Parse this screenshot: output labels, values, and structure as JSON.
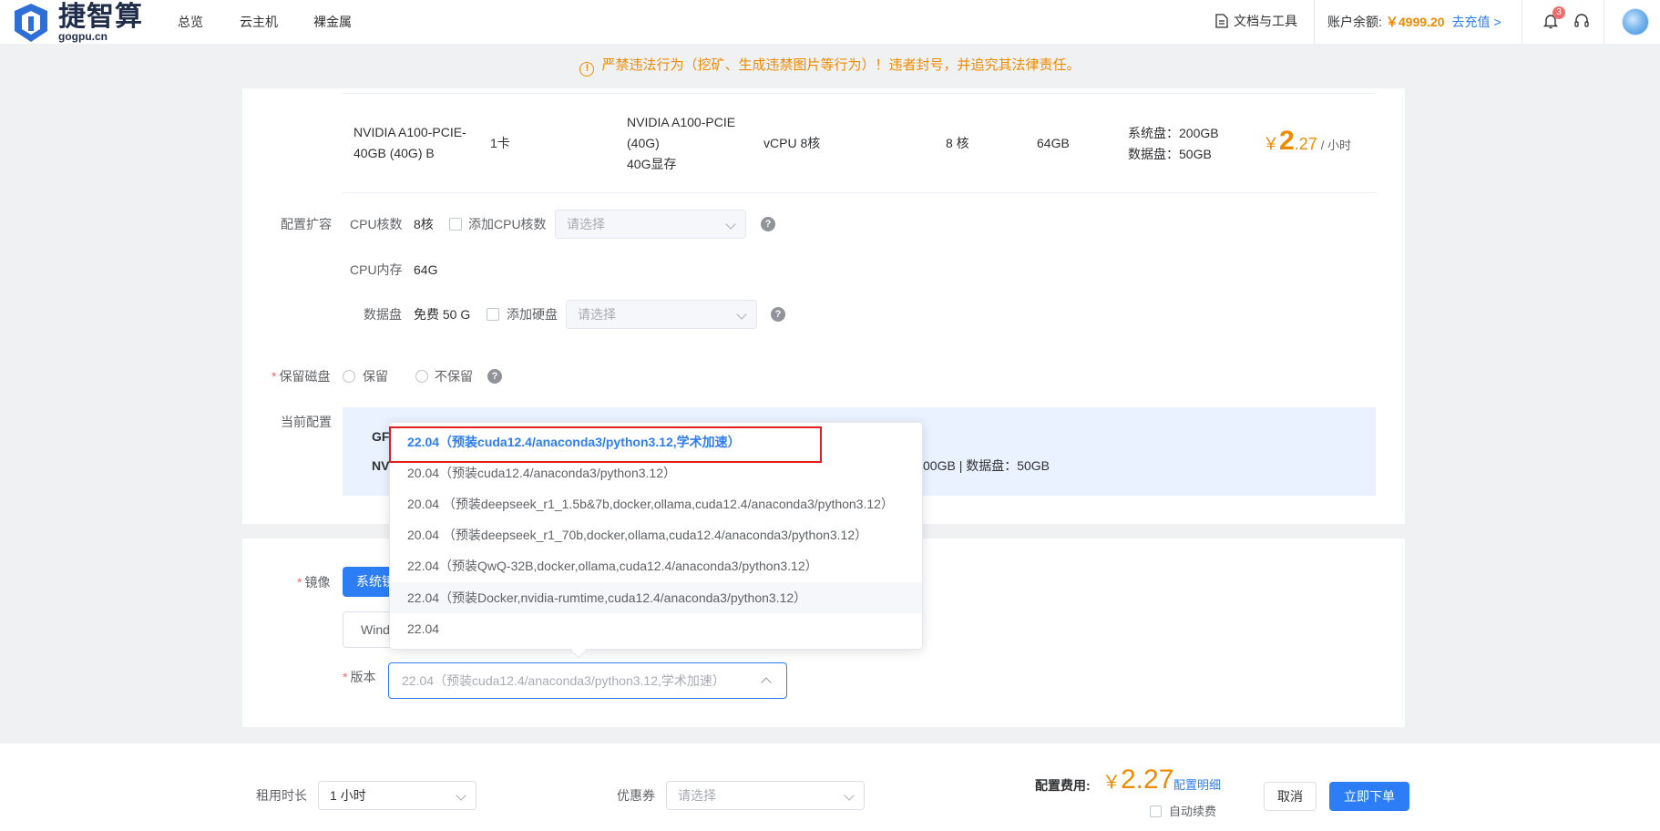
{
  "header": {
    "logo_text": "捷智算",
    "logo_sub": "gogpu.cn",
    "nav": [
      "总览",
      "云主机",
      "裸金属"
    ],
    "docs_label": "文档与工具",
    "balance_label": "账户余额:",
    "balance_amount": "￥4999.20",
    "recharge_label": "去充值 >",
    "notification_count": "3"
  },
  "warning": {
    "text": "严禁违法行为（挖矿、生成违禁图片等行为）！违者封号，并追究其法律责任。"
  },
  "gpu_row": {
    "name": "NVIDIA A100-PCIE-40GB (40G) B",
    "card_count": "1卡",
    "gpu_model_line1": "NVIDIA A100-PCIE",
    "gpu_model_line2": "(40G)",
    "gpu_model_line3": "40G显存",
    "vcpu": "vCPU 8核",
    "cores": "8 核",
    "memory": "64GB",
    "system_disk": "系统盘：200GB",
    "data_disk": "数据盘：50GB",
    "price_yen": "￥",
    "price_int": "2",
    "price_dec": ".27",
    "price_unit": "/ 小时"
  },
  "config_expand": {
    "section_label": "配置扩容",
    "cpu_cores_label": "CPU核数",
    "cpu_cores_value": "8核",
    "add_cpu_label": "添加CPU核数",
    "add_cpu_placeholder": "请选择",
    "cpu_mem_label": "CPU内存",
    "cpu_mem_value": "64G",
    "data_disk_label": "数据盘",
    "data_disk_value": "免费 50 G",
    "add_disk_label": "添加硬盘",
    "add_disk_placeholder": "请选择"
  },
  "keep_disk": {
    "label": "保留磁盘",
    "options": [
      "保留",
      "不保留"
    ]
  },
  "current_config": {
    "label": "当前配置",
    "line1_prefix": "GF",
    "line2_prefix": "NV",
    "line2_tail": "00GB | 数据盘：50GB"
  },
  "image": {
    "label": "镜像",
    "tab_system": "系统镜",
    "os_value": "Wind",
    "version_label": "版本",
    "version_value": "22.04（预装cuda12.4/anaconda3/python3.12,学术加速）"
  },
  "version_dropdown": {
    "options": [
      "22.04（预装cuda12.4/anaconda3/python3.12,学术加速）",
      "20.04（预装cuda12.4/anaconda3/python3.12）",
      "20.04 （预装deepseek_r1_1.5b&7b,docker,ollama,cuda12.4/anaconda3/python3.12）",
      "20.04 （预装deepseek_r1_70b,docker,ollama,cuda12.4/anaconda3/python3.12）",
      "22.04（预装QwQ-32B,docker,ollama,cuda12.4/anaconda3/python3.12）",
      "22.04（预装Docker,nvidia-rumtime,cuda12.4/anaconda3/python3.12）",
      "22.04"
    ],
    "selected_index": 0,
    "hover_index": 5
  },
  "footer": {
    "duration_label": "租用时长",
    "duration_value": "1 小时",
    "coupon_label": "优惠券",
    "coupon_placeholder": "请选择",
    "fee_label": "配置费用:",
    "fee_yen": "￥",
    "fee_amount": "2.27",
    "fee_detail": "配置明细",
    "auto_renew": "自动续费",
    "cancel": "取消",
    "order": "立即下单"
  },
  "colors": {
    "accent": "#2d7df6",
    "price": "#f08a00",
    "highlight_box": "#e02020"
  }
}
